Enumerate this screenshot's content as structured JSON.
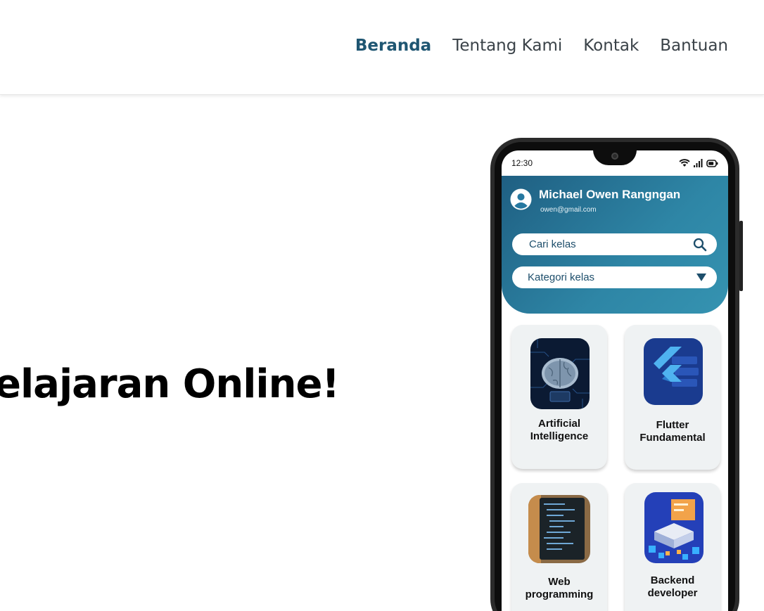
{
  "nav": {
    "links": [
      "Beranda",
      "Tentang Kami",
      "Kontak",
      "Bantuan"
    ],
    "active": "Beranda"
  },
  "hero": {
    "title": "elajaran Online!"
  },
  "phone": {
    "status": {
      "time": "12:30"
    },
    "user": {
      "name": "Michael Owen Rangngan",
      "email": "owen@gmail.com"
    },
    "search": {
      "placeholder": "Cari kelas"
    },
    "category": {
      "label": "Kategori kelas"
    },
    "courses": [
      {
        "line1": "Artificial",
        "line2": "Intelligence"
      },
      {
        "line1": "Flutter",
        "line2": "Fundamental"
      },
      {
        "line1": "Web",
        "line2": "programming"
      },
      {
        "line1": "Backend",
        "line2": "developer"
      }
    ]
  },
  "colors": {
    "brand": "#1f5672",
    "header_gradient_start": "#1f5f82",
    "header_gradient_end": "#3593b1",
    "card_bg": "#eff2f3"
  }
}
